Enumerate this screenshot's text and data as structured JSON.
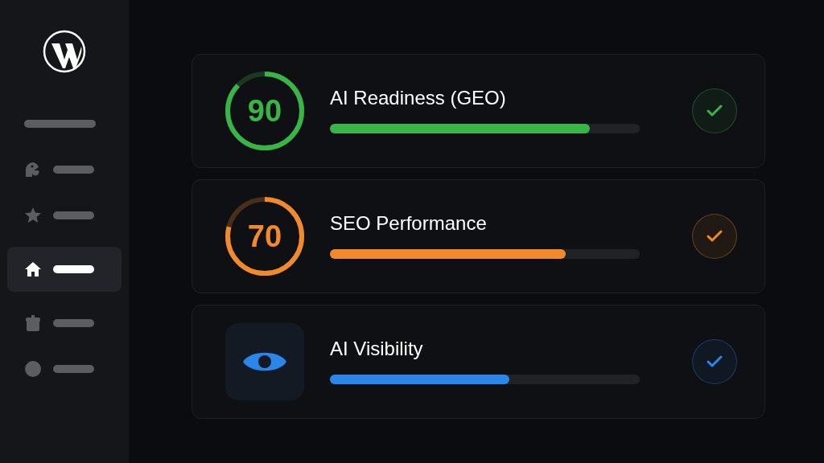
{
  "sidebar": {
    "items": [
      {
        "kind": "none",
        "selected": false
      },
      {
        "kind": "head",
        "selected": false
      },
      {
        "kind": "star",
        "selected": false
      },
      {
        "kind": "home",
        "selected": true
      },
      {
        "kind": "jar",
        "selected": false
      },
      {
        "kind": "circle",
        "selected": false
      }
    ]
  },
  "cards": [
    {
      "kind": "score",
      "score": "90",
      "title": "AI Readiness (GEO)",
      "color": "#38b449",
      "bar": {
        "level": 0.84
      },
      "checked": true
    },
    {
      "kind": "score",
      "score": "70",
      "title": "SEO Performance",
      "color": "#f08a2c",
      "bar": {
        "level": 0.76
      },
      "checked": true
    },
    {
      "kind": "eye",
      "title": "AI Visibility",
      "color": "#2a86e8",
      "bar": {
        "level": 0.58
      },
      "checked": true
    }
  ]
}
